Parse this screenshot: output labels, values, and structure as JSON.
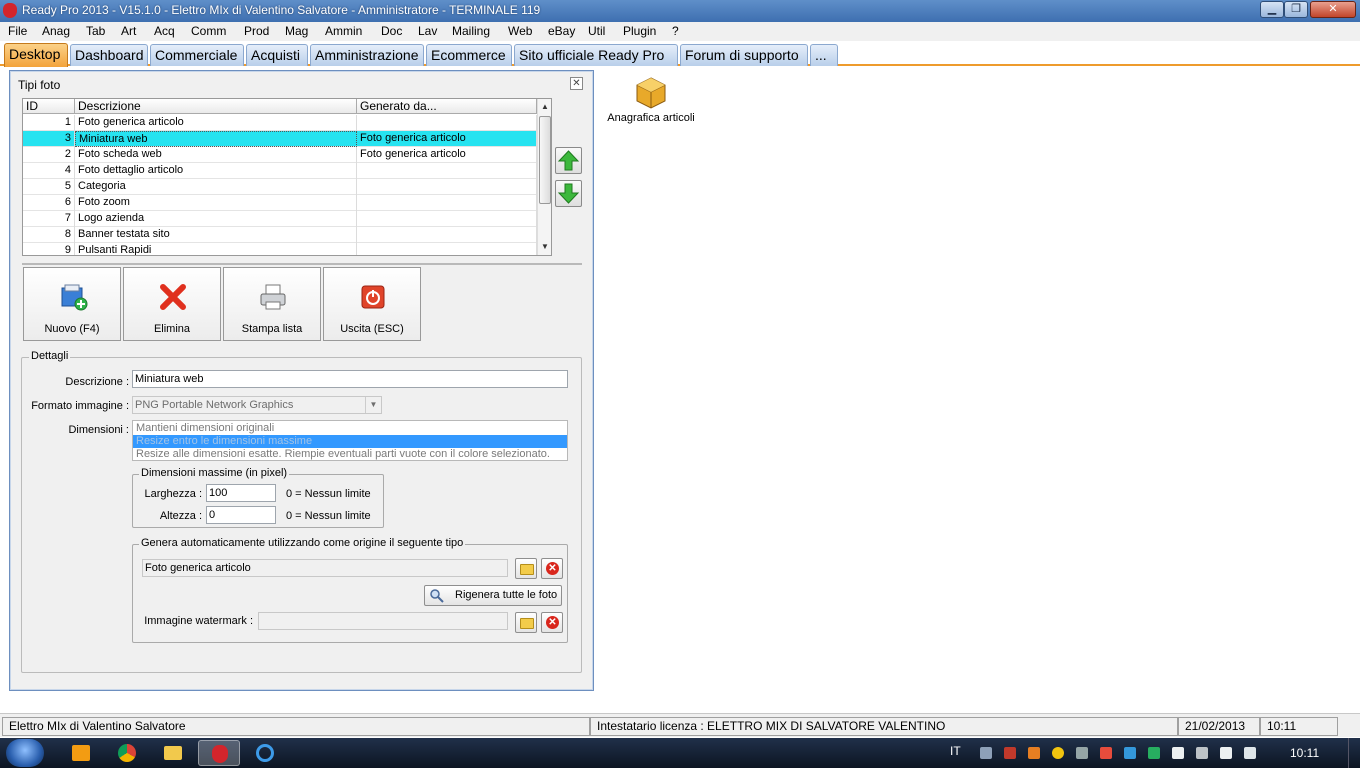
{
  "window": {
    "title": "Ready Pro 2013 - V15.1.0 - Elettro MIx di Valentino Salvatore - Amministratore - TERMINALE 119",
    "minimize": "▁",
    "restore": "❐",
    "close": "✕"
  },
  "menu": [
    "File",
    "Anag",
    "Tab",
    "Art",
    "Acq",
    "Comm",
    "Prod",
    "Mag",
    "Ammin",
    "Doc",
    "Lav",
    "Mailing",
    "Web",
    "eBay",
    "Util",
    "Plugin",
    "?"
  ],
  "tabs": [
    "Desktop",
    "Dashboard",
    "Commerciale",
    "Acquisti",
    "Amministrazione",
    "Ecommerce",
    "Sito ufficiale Ready Pro",
    "Forum di supporto",
    "..."
  ],
  "active_tab": "Desktop",
  "child_window": {
    "title": "Tipi foto",
    "close": "✕",
    "grid": {
      "columns": [
        "ID",
        "Descrizione",
        "Generato da..."
      ],
      "rows": [
        {
          "id": "1",
          "descrizione": "Foto generica articolo",
          "generato": ""
        },
        {
          "id": "3",
          "descrizione": "Miniatura web",
          "generato": "Foto generica articolo",
          "selected": true
        },
        {
          "id": "2",
          "descrizione": "Foto scheda web",
          "generato": "Foto generica articolo"
        },
        {
          "id": "4",
          "descrizione": "Foto dettaglio articolo",
          "generato": ""
        },
        {
          "id": "5",
          "descrizione": "Categoria",
          "generato": ""
        },
        {
          "id": "6",
          "descrizione": "Foto zoom",
          "generato": ""
        },
        {
          "id": "7",
          "descrizione": "Logo azienda",
          "generato": ""
        },
        {
          "id": "8",
          "descrizione": "Banner testata sito",
          "generato": ""
        },
        {
          "id": "9",
          "descrizione": "Pulsanti Rapidi",
          "generato": ""
        }
      ]
    },
    "toolbar": {
      "new": "Nuovo (F4)",
      "delete": "Elimina",
      "print": "Stampa lista",
      "exit": "Uscita (ESC)"
    },
    "details": {
      "legend": "Dettagli",
      "descrizione_label": "Descrizione :",
      "descrizione_value": "Miniatura web",
      "formato_label": "Formato immagine :",
      "formato_value": "PNG Portable Network Graphics",
      "dimensioni_label": "Dimensioni :",
      "dimensioni_options": [
        "Mantieni dimensioni originali",
        "Resize entro le dimensioni massime",
        "Resize alle dimensioni esatte. Riempie eventuali parti vuote con il colore selezionato."
      ],
      "dimensioni_selected_index": 1,
      "max_group_legend": "Dimensioni massime (in pixel)",
      "larghezza_label": "Larghezza :",
      "larghezza_value": "100",
      "altezza_label": "Altezza :",
      "altezza_value": "0",
      "nessun_limite": "0 = Nessun limite",
      "origin_group_legend": "Genera automaticamente utilizzando come origine il seguente tipo",
      "origin_value": "Foto generica articolo",
      "rigenera_button": "Rigenera tutte le foto",
      "watermark_label": "Immagine watermark :",
      "watermark_value": ""
    }
  },
  "desktop_icons": [
    {
      "label": "Anagrafica articoli"
    }
  ],
  "statusbar": {
    "company": "Elettro MIx di Valentino Salvatore",
    "license": "Intestatario licenza : ELETTRO MIX DI SALVATORE VALENTINO",
    "date": "21/02/2013",
    "time": "10:11"
  },
  "taskbar": {
    "language": "IT",
    "clock": "10:11"
  }
}
